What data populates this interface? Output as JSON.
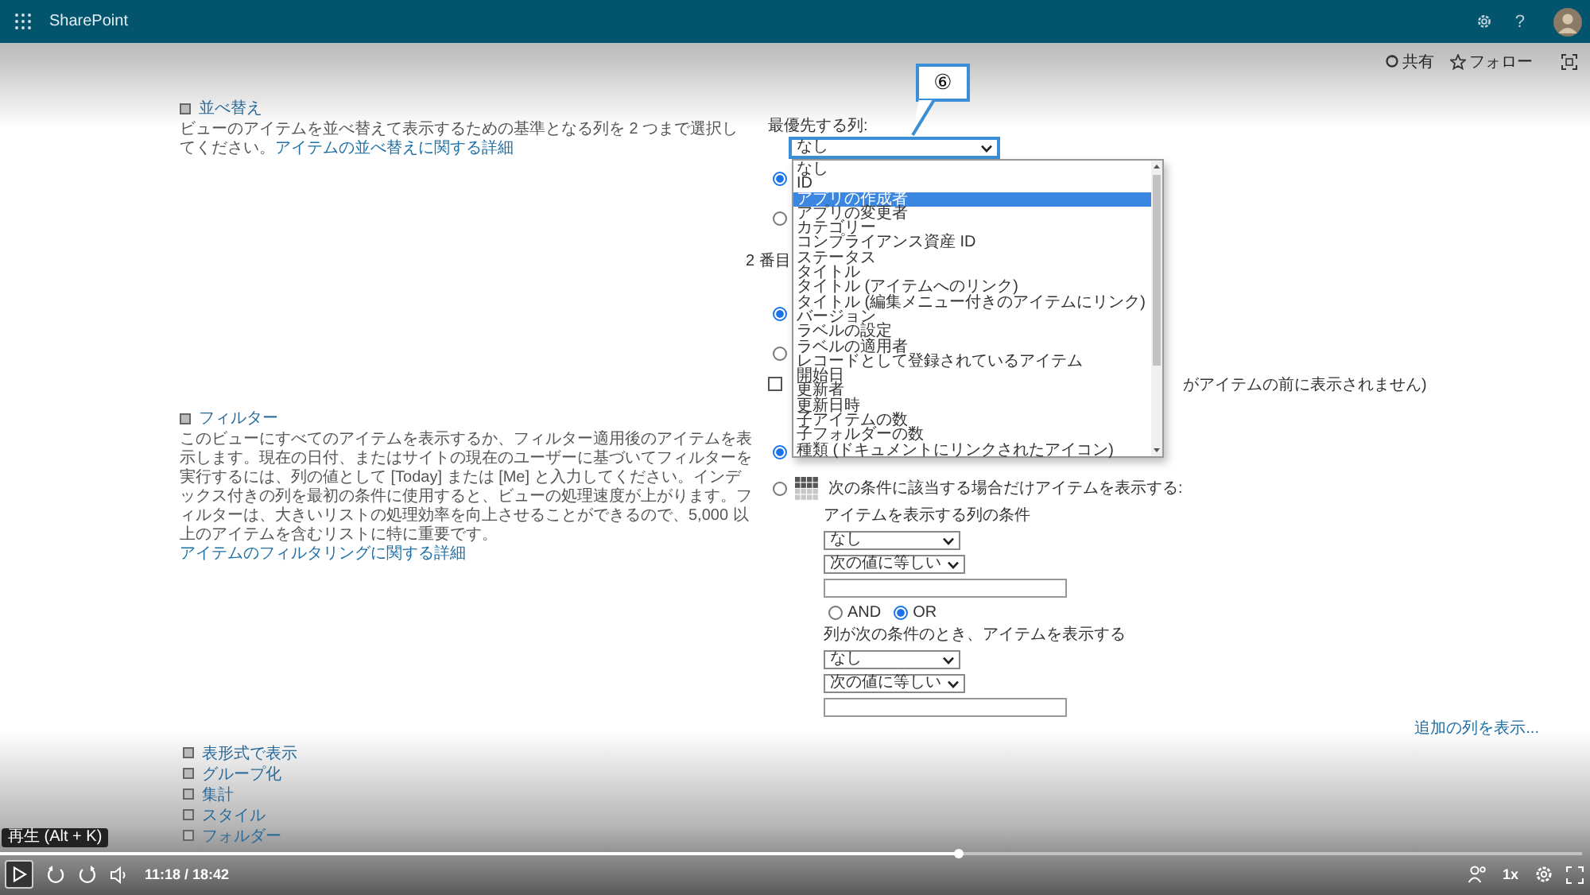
{
  "app_bar": {
    "title": "SharePoint",
    "help": "?"
  },
  "command_bar": [
    {
      "kind": "share",
      "label": "共有"
    },
    {
      "kind": "follow",
      "label": "フォロー"
    }
  ],
  "sort_section": {
    "heading": "並べ替え",
    "description": "ビューのアイテムを並べ替えて表示するための基準となる列を 2 つまで選択してください。",
    "link": "アイテムの並べ替えに関する詳細"
  },
  "sort_form": {
    "label": "最優先する列:",
    "select_value": "なし",
    "first_radios": [
      {
        "selected": true
      },
      {
        "selected": false
      }
    ],
    "second_label": "2 番目",
    "second_radios": [
      {
        "selected": true
      },
      {
        "selected": false
      }
    ],
    "checkbox": {
      "checked": false,
      "label_tail": "がアイテムの前に表示されません)"
    }
  },
  "callout": {
    "label": "⑥"
  },
  "dropdown": {
    "items": [
      {
        "label": "なし",
        "selected": false
      },
      {
        "label": "ID",
        "selected": false
      },
      {
        "label": "アプリの作成者",
        "selected": true
      },
      {
        "label": "アプリの変更者",
        "selected": false
      },
      {
        "label": "カテゴリー",
        "selected": false
      },
      {
        "label": "コンプライアンス資産 ID",
        "selected": false
      },
      {
        "label": "ステータス",
        "selected": false
      },
      {
        "label": "タイトル",
        "selected": false
      },
      {
        "label": "タイトル (アイテムへのリンク)",
        "selected": false
      },
      {
        "label": "タイトル (編集メニュー付きのアイテムにリンク)",
        "selected": false
      },
      {
        "label": "バージョン",
        "selected": false
      },
      {
        "label": "ラベルの設定",
        "selected": false
      },
      {
        "label": "ラベルの適用者",
        "selected": false
      },
      {
        "label": "レコードとして登録されているアイテム",
        "selected": false
      },
      {
        "label": "開始日",
        "selected": false
      },
      {
        "label": "更新者",
        "selected": false
      },
      {
        "label": "更新日時",
        "selected": false
      },
      {
        "label": "子アイテムの数",
        "selected": false
      },
      {
        "label": "子フォルダーの数",
        "selected": false
      },
      {
        "label": "種類 (ドキュメントにリンクされたアイコン)",
        "selected": false
      }
    ]
  },
  "filter_section": {
    "heading": "フィルター",
    "description": "このビューにすべてのアイテムを表示するか、フィルター適用後のアイテムを表示します。現在の日付、またはサイトの現在のユーザーに基づいてフィルターを実行するには、列の値として [Today] または [Me] と入力してください。インデックス付きの列を最初の条件に使用すると、ビューの処理速度が上がります。フィルターは、大きいリストの処理効率を向上させることができるので、5,000 以上のアイテムを含むリストに特に重要です。",
    "link": "アイテムのフィルタリングに関する詳細"
  },
  "filter_form": {
    "options": [
      {
        "selected": true
      },
      {
        "selected": false,
        "label": "次の条件に該当する場合だけアイテムを表示する:"
      }
    ],
    "condition_label": "アイテムを表示する列の条件",
    "first_condition": {
      "column": "なし",
      "operator": "次の値に等しい"
    },
    "joins": [
      {
        "label": "AND",
        "selected": false
      },
      {
        "label": "OR",
        "selected": true
      }
    ],
    "second_label": "列が次の条件のとき、アイテムを表示する",
    "second_condition": {
      "column": "なし",
      "operator": "次の値に等しい"
    }
  },
  "more_columns_link": "追加の列を表示...",
  "collapsed_sections": [
    "表形式で表示",
    "グループ化",
    "集計",
    "スタイル",
    "フォルダー"
  ],
  "player": {
    "tooltip": "再生 (Alt + K)",
    "time": "11:18 / 18:42",
    "speed": "1x",
    "progress": {
      "level": 0.606
    }
  }
}
